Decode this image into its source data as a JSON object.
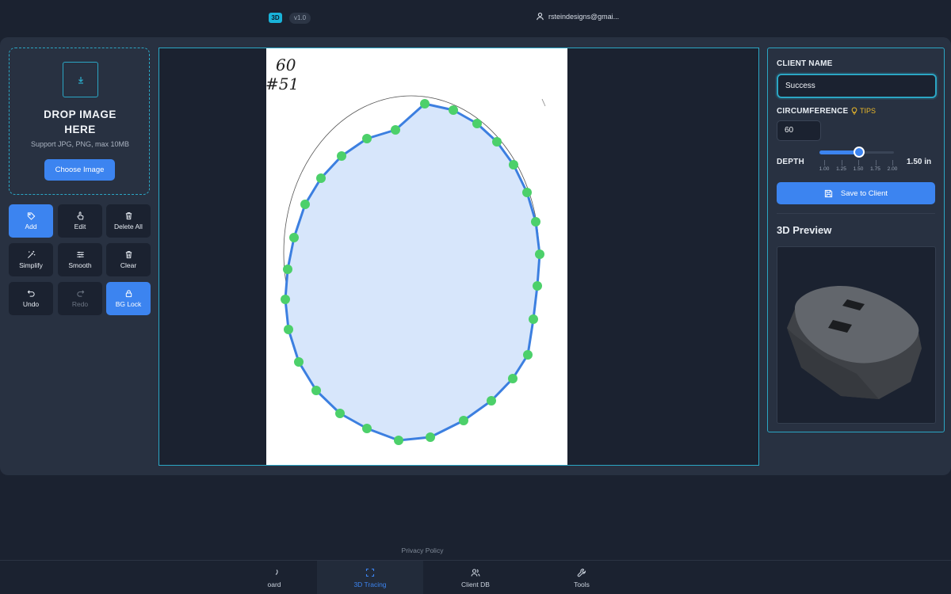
{
  "header": {
    "logo_text": "3D",
    "version": "v1.0",
    "user_email": "rsteindesigns@gmai...",
    "accent": "#19b3d9"
  },
  "upload": {
    "title": "DROP IMAGE HERE",
    "subtitle": "Support JPG, PNG, max 10MB",
    "choose_label": "Choose Image",
    "icon": "download-icon"
  },
  "tools": [
    {
      "label": "Add",
      "icon": "tag-icon",
      "state": "active"
    },
    {
      "label": "Edit",
      "icon": "pointer-hand-icon",
      "state": "normal"
    },
    {
      "label": "Delete All",
      "icon": "trash-icon",
      "state": "normal"
    },
    {
      "label": "Simplify",
      "icon": "magic-wand-icon",
      "state": "normal"
    },
    {
      "label": "Smooth",
      "icon": "sliders-icon",
      "state": "normal"
    },
    {
      "label": "Clear",
      "icon": "trash-icon",
      "state": "normal"
    },
    {
      "label": "Undo",
      "icon": "undo-icon",
      "state": "normal"
    },
    {
      "label": "Redo",
      "icon": "redo-icon",
      "state": "disabled"
    },
    {
      "label": "BG Lock",
      "icon": "lock-icon",
      "state": "active"
    }
  ],
  "canvas": {
    "annotation_line1": "60",
    "annotation_line2": "#51",
    "point_color": "#4cd06a",
    "path_color": "#3c7fe0",
    "fill_color": "#d7e6fb"
  },
  "settings": {
    "client_name_label": "CLIENT NAME",
    "client_name_value": "Success",
    "circumference_label": "CIRCUMFERENCE",
    "tips_label": "TIPS",
    "circumference_value": "60",
    "depth_label": "DEPTH",
    "depth_value": "1.50 in",
    "depth_fraction": 0.5,
    "depth_ticks": [
      "1.00",
      "1.25",
      "1.50",
      "1.75",
      "2.00"
    ],
    "save_label": "Save to Client",
    "preview_title": "3D Preview"
  },
  "footer": {
    "privacy": "Privacy Policy"
  },
  "nav": {
    "items": [
      {
        "label": "oard",
        "icon": "dashboard-icon"
      },
      {
        "label": "3D Tracing",
        "icon": "scan-frame-icon",
        "active": true
      },
      {
        "label": "Client DB",
        "icon": "users-icon"
      },
      {
        "label": "Tools",
        "icon": "wrench-icon"
      }
    ]
  }
}
